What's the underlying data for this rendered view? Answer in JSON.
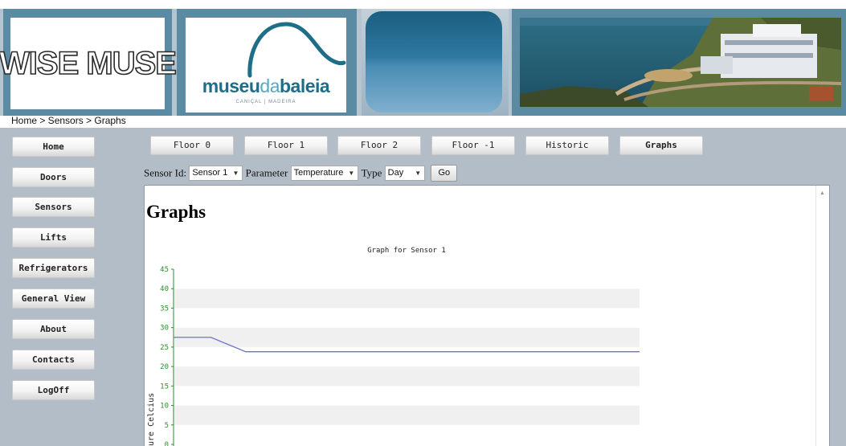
{
  "header": {
    "logo_text": "WISE MUSE",
    "museum_logo": {
      "part1": "museu",
      "part2": "da",
      "part3": "baleia",
      "subtitle": "CANIÇAL | MADEIRA"
    }
  },
  "breadcrumb": "Home > Sensors > Graphs",
  "sidebar": {
    "items": [
      {
        "label": "Home"
      },
      {
        "label": "Doors"
      },
      {
        "label": "Sensors"
      },
      {
        "label": "Lifts"
      },
      {
        "label": "Refrigerators"
      },
      {
        "label": "General View"
      },
      {
        "label": "About"
      },
      {
        "label": "Contacts"
      },
      {
        "label": "LogOff"
      }
    ]
  },
  "topnav": {
    "items": [
      {
        "label": "Floor 0"
      },
      {
        "label": "Floor 1"
      },
      {
        "label": "Floor 2"
      },
      {
        "label": "Floor -1"
      },
      {
        "label": "Historic"
      },
      {
        "label": "Graphs",
        "active": true
      }
    ]
  },
  "form": {
    "sensor_label": "Sensor Id:",
    "sensor_value": "Sensor 1",
    "parameter_label": "Parameter",
    "parameter_value": "Temperature",
    "type_label": "Type",
    "type_value": "Day",
    "go_label": "Go"
  },
  "content": {
    "title": "Graphs"
  },
  "chart_data": {
    "type": "line",
    "title": "Graph for Sensor 1",
    "ylabel": "ure Celcius",
    "ylim": [
      0,
      45
    ],
    "yticks": [
      0,
      5,
      10,
      15,
      20,
      25,
      30,
      35,
      40,
      45
    ],
    "series": [
      {
        "x": [
          0,
          0.08,
          0.155,
          1.0
        ],
        "values": [
          27.5,
          27.5,
          23.8,
          23.8
        ]
      }
    ],
    "colors": {
      "line": "#6f72c9",
      "axis": "#2e8b2e",
      "tick_text": "#2e8b2e",
      "band": "#f0f0f0"
    },
    "grid": "horizontal alternating bands",
    "legend": "none"
  },
  "colors": {
    "header_bg": "#b4c4d0",
    "panel_frame": "#5b8ba3",
    "main_bg": "#b3bdc8"
  }
}
